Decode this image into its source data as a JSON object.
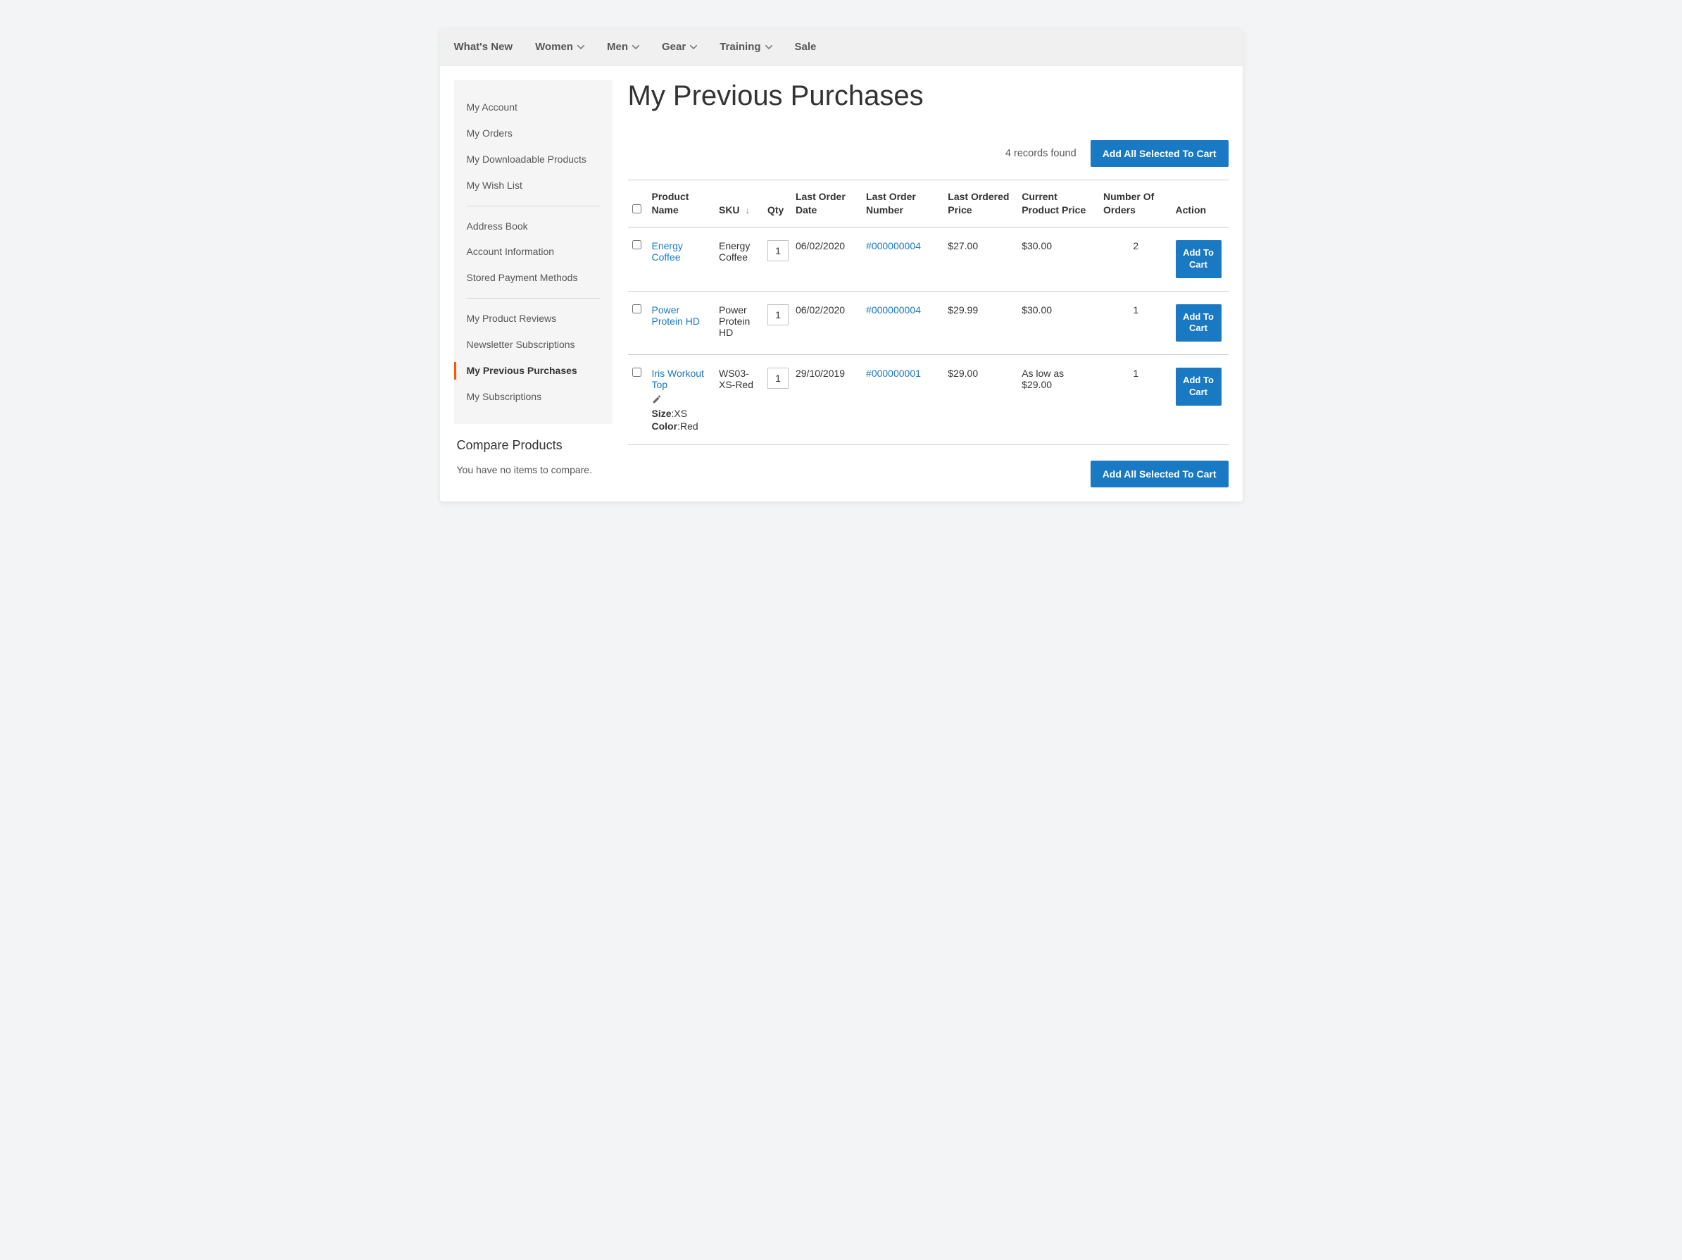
{
  "nav": [
    {
      "label": "What's New",
      "hasDropdown": false
    },
    {
      "label": "Women",
      "hasDropdown": true
    },
    {
      "label": "Men",
      "hasDropdown": true
    },
    {
      "label": "Gear",
      "hasDropdown": true
    },
    {
      "label": "Training",
      "hasDropdown": true
    },
    {
      "label": "Sale",
      "hasDropdown": false
    }
  ],
  "sidebar": {
    "groups": [
      [
        "My Account",
        "My Orders",
        "My Downloadable Products",
        "My Wish List"
      ],
      [
        "Address Book",
        "Account Information",
        "Stored Payment Methods"
      ],
      [
        "My Product Reviews",
        "Newsletter Subscriptions",
        "My Previous Purchases",
        "My Subscriptions"
      ]
    ],
    "activeLabel": "My Previous Purchases"
  },
  "page": {
    "title": "My Previous Purchases",
    "records_found": "4 records found",
    "add_all_label": "Add All Selected To Cart",
    "add_to_cart_label": "Add To Cart"
  },
  "table": {
    "headers": {
      "product_name": "Product Name",
      "sku": "SKU",
      "qty": "Qty",
      "last_order_date": "Last Order Date",
      "last_order_number": "Last Order Number",
      "last_ordered_price": "Last Ordered Price",
      "current_price": "Current Product Price",
      "num_orders": "Number Of Orders",
      "action": "Action"
    },
    "sort_indicator": "↓",
    "rows": [
      {
        "name": "Energy Coffee",
        "sku": "Energy Coffee",
        "qty": "1",
        "date": "06/02/2020",
        "order_no": "#000000004",
        "last_price": "$27.00",
        "current_price": "$30.00",
        "num_orders": "2",
        "editable": false,
        "attrs": []
      },
      {
        "name": "Power Protein HD",
        "sku": "Power Protein HD",
        "qty": "1",
        "date": "06/02/2020",
        "order_no": "#000000004",
        "last_price": "$29.99",
        "current_price": "$30.00",
        "num_orders": "1",
        "editable": false,
        "attrs": []
      },
      {
        "name": "Iris Workout Top",
        "sku": "WS03-XS-Red",
        "qty": "1",
        "date": "29/10/2019",
        "order_no": "#000000001",
        "last_price": "$29.00",
        "current_price": "As low as $29.00",
        "num_orders": "1",
        "editable": true,
        "attrs": [
          {
            "label": "Size",
            "value": "XS"
          },
          {
            "label": "Color",
            "value": "Red"
          }
        ]
      }
    ]
  },
  "compare": {
    "title": "Compare Products",
    "empty": "You have no items to compare."
  }
}
